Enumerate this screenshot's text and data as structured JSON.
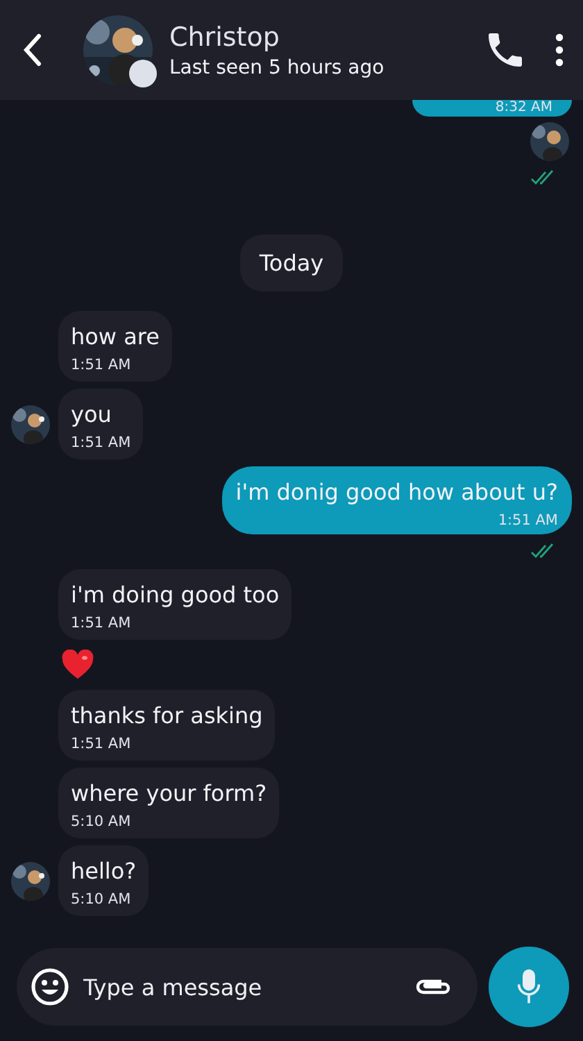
{
  "header": {
    "name": "Christop",
    "status": "Last seen 5 hours ago",
    "online": false
  },
  "messages": [
    {
      "kind": "sent",
      "time": "8:32 AM",
      "clipped": true,
      "seen": true
    },
    {
      "kind": "date",
      "text": "Today"
    },
    {
      "kind": "received",
      "text": "how are",
      "time": "1:51 AM",
      "avatar": false
    },
    {
      "kind": "received",
      "text": "you",
      "time": "1:51 AM",
      "avatar": true
    },
    {
      "kind": "sent",
      "text": "i'm donig good how about u?",
      "time": "1:51 AM",
      "clipped": false,
      "seen": true
    },
    {
      "kind": "received",
      "text": "i'm doing good too",
      "time": "1:51 AM",
      "avatar": false
    },
    {
      "kind": "heart"
    },
    {
      "kind": "received",
      "text": "thanks for asking",
      "time": "1:51 AM",
      "avatar": false
    },
    {
      "kind": "received",
      "text": "where your form?",
      "time": "5:10 AM",
      "avatar": false
    },
    {
      "kind": "received",
      "text": "hello?",
      "time": "5:10 AM",
      "avatar": true
    }
  ],
  "composer": {
    "placeholder": "Type a message"
  }
}
